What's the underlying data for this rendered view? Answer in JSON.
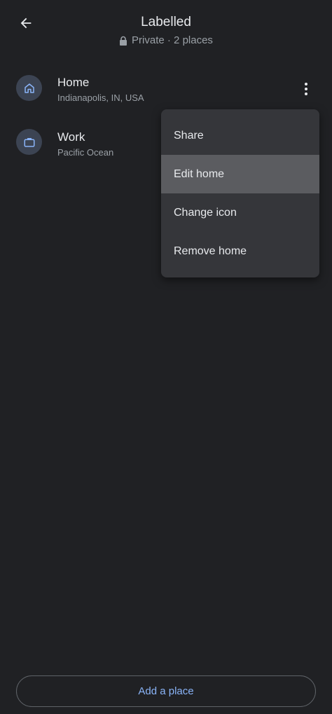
{
  "header": {
    "title": "Labelled",
    "subtitle": "Private · 2 places"
  },
  "places": [
    {
      "title": "Home",
      "subtitle": "Indianapolis, IN, USA",
      "icon": "home-icon"
    },
    {
      "title": "Work",
      "subtitle": "Pacific Ocean",
      "icon": "briefcase-icon"
    }
  ],
  "menu": {
    "items": [
      {
        "label": "Share"
      },
      {
        "label": "Edit home"
      },
      {
        "label": "Change icon"
      },
      {
        "label": "Remove home"
      }
    ],
    "highlighted_index": 1
  },
  "footer": {
    "add_label": "Add a place"
  },
  "colors": {
    "background": "#202124",
    "menu": "#35363a",
    "menu_highlight": "#5b5c60",
    "accent": "#8ab4f8",
    "icon_bg": "#3c4453"
  }
}
